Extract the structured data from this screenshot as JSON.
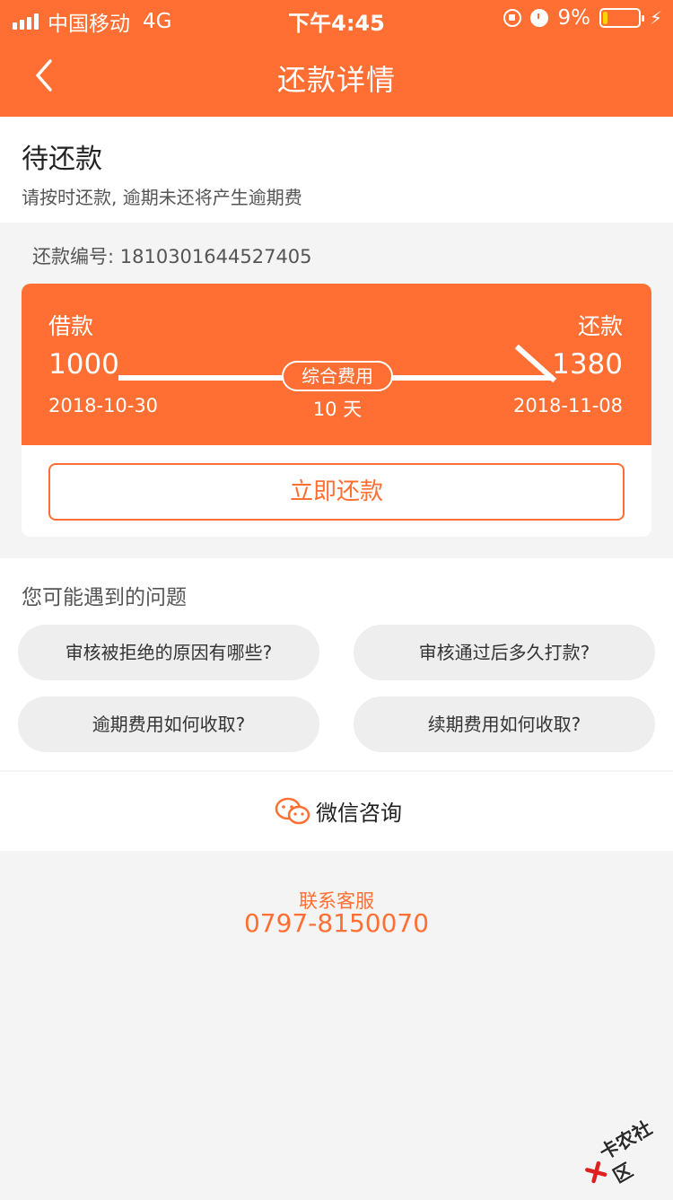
{
  "status_bar": {
    "carrier": "中国移动",
    "network": "4G",
    "time": "下午4:45",
    "battery_percent": "9%",
    "battery_level": 0.09
  },
  "nav": {
    "title": "还款详情",
    "back_icon": "chevron-left-icon"
  },
  "pending": {
    "title": "待还款",
    "subtitle": "请按时还款, 逾期未还将产生逾期费"
  },
  "repay_number": "还款编号: 1810301644527405",
  "card": {
    "borrow_label": "借款",
    "borrow_amount": "1000",
    "borrow_date": "2018-10-30",
    "repay_label": "还款",
    "repay_amount": "1380",
    "repay_date": "2018-11-08",
    "fee_label": "综合费用",
    "days": "10 天",
    "repay_button": "立即还款"
  },
  "faq": {
    "title": "您可能遇到的问题",
    "items": [
      "审核被拒绝的原因有哪些?",
      "审核通过后多久打款?",
      "逾期费用如何收取?",
      "续期费用如何收取?"
    ]
  },
  "wechat": {
    "label": "微信咨询",
    "icon": "wechat-icon"
  },
  "contact": {
    "label": "联系客服",
    "phone": "0797-8150070"
  },
  "watermark": {
    "text": "卡农社区"
  },
  "colors": {
    "accent": "#ff6f33",
    "background": "#f4f4f4",
    "pill": "#eeeeee"
  }
}
